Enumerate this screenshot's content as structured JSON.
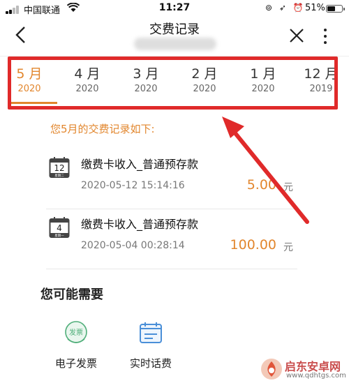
{
  "status_bar": {
    "carrier": "中国联通",
    "time": "11:27",
    "status_icons": "⊚ ➶ ⏰",
    "battery": "51%"
  },
  "nav": {
    "title": "交费记录",
    "back_icon": "chevron-left-icon",
    "close_icon": "close-icon",
    "more_icon": "more-vertical-icon"
  },
  "month_tabs": [
    {
      "month": "5 月",
      "year": "2020",
      "active": true
    },
    {
      "month": "4 月",
      "year": "2020",
      "active": false
    },
    {
      "month": "3 月",
      "year": "2020",
      "active": false
    },
    {
      "month": "2 月",
      "year": "2020",
      "active": false
    },
    {
      "month": "1 月",
      "year": "2020",
      "active": false
    },
    {
      "month": "12 月",
      "year": "2019",
      "active": false
    }
  ],
  "records_header": "您5月的交费记录如下:",
  "records": [
    {
      "day": "12",
      "weekday": "星期二",
      "name": "缴费卡收入_普通预存款",
      "datetime": "2020-05-12 15:14:16",
      "amount": "5.00",
      "unit": "元"
    },
    {
      "day": "4",
      "weekday": "星期一",
      "name": "缴费卡收入_普通预存款",
      "datetime": "2020-05-04 00:28:14",
      "amount": "100.00",
      "unit": "元"
    }
  ],
  "you_may_need": {
    "title": "您可能需要",
    "services": [
      {
        "label": "电子发票",
        "icon_text": "发票",
        "icon": "invoice-icon"
      },
      {
        "label": "实时话费",
        "icon": "bill-card-icon"
      }
    ]
  },
  "watermark": {
    "text": "启东安卓网",
    "url": "www.qdhtgs.com"
  },
  "colors": {
    "accent": "#e2862d",
    "annotation_red": "#e02a2a",
    "invoice_green": "#4fae79",
    "bill_blue": "#4a8fd8"
  }
}
